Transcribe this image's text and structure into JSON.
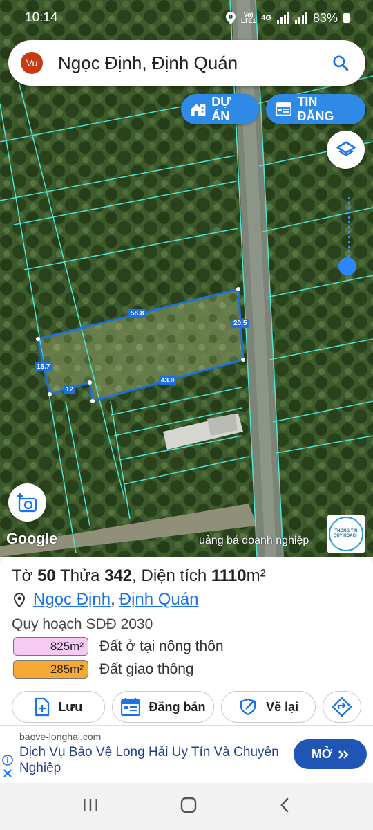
{
  "status_bar": {
    "time": "10:14",
    "network_top": "Vo)",
    "network_bottom": "LTE1",
    "network_type": "4G",
    "battery": "83%"
  },
  "search": {
    "avatar_text": "Vu",
    "query": "Ngọc Định, Định Quán"
  },
  "map_buttons": {
    "du_an": "DỰ ÁN",
    "tin_dang": "TIN ĐĂNG"
  },
  "map": {
    "measurements": [
      "58.8",
      "20.5",
      "15.7",
      "12",
      "43.9"
    ],
    "google_logo": "Google",
    "promo_text": "uảng bá doanh nghiệp",
    "badge_line1": "THÔNG TIN",
    "badge_line2": "QUY HOẠCH"
  },
  "parcel": {
    "label_to": "Tờ",
    "to_value": "50",
    "label_thua": "Thửa",
    "thua_value": "342",
    "label_area": ", Diện tích",
    "area_value": "1110",
    "area_unit": "m²",
    "ward": "Ngọc Định",
    "district": "Định Quán",
    "plan_label": "Quy hoạch SDĐ 2030",
    "zones": [
      {
        "area": "825m²",
        "name": "Đất ở tại nông thôn",
        "color": "#f7c9f5"
      },
      {
        "area": "285m²",
        "name": "Đất giao thông",
        "color": "#f6a934"
      }
    ]
  },
  "actions": {
    "save": "Lưu",
    "sell": "Đăng bán",
    "redraw": "Vẽ lại"
  },
  "ad": {
    "domain": "baove-longhai.com",
    "headline": "Dịch Vụ Bảo Vệ Long Hải Uy Tín Và Chuyên Nghiệp",
    "cta": "MỞ"
  },
  "colors": {
    "accent": "#2e8ae6",
    "parcel_line": "#1e6fe0",
    "plot_lines": "#4fe3d1",
    "ad_button": "#1f55b5"
  }
}
